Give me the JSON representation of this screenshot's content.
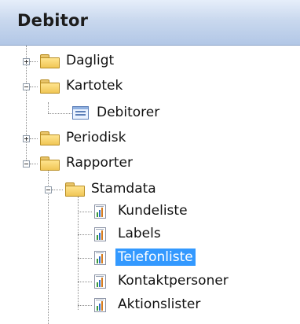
{
  "panel": {
    "title": "Debitor"
  },
  "tree": {
    "dagligt": "Dagligt",
    "kartotek": "Kartotek",
    "debitorer": "Debitorer",
    "periodisk": "Periodisk",
    "rapporter": "Rapporter",
    "stamdata": "Stamdata",
    "kundeliste": "Kundeliste",
    "labels": "Labels",
    "telefonliste": "Telefonliste",
    "kontaktpersoner": "Kontaktpersoner",
    "aktionslister": "Aktionslister"
  },
  "selected_item": "Telefonliste",
  "colors": {
    "selection": "#3399ff",
    "header_gradient_top": "#e6eefa",
    "header_gradient_bottom": "#b2c7e6"
  }
}
